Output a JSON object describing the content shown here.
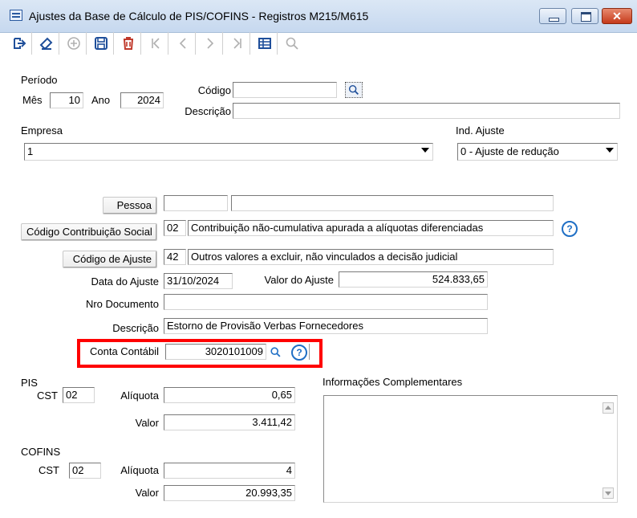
{
  "window": {
    "title": "Ajustes da Base de Cálculo de PIS/COFINS - Registros M215/M615"
  },
  "toolbar": {
    "icons": [
      "exit-icon",
      "eraser-icon",
      "add-icon",
      "save-icon",
      "delete-icon",
      "first-icon",
      "previous-icon",
      "next-icon",
      "last-icon",
      "grid-icon",
      "search-icon"
    ]
  },
  "periodo": {
    "label": "Período",
    "mes_label": "Mês",
    "mes": "10",
    "ano_label": "Ano",
    "ano": "2024"
  },
  "codigo": {
    "label": "Código",
    "value": "",
    "descricao_label": "Descrição",
    "descricao": ""
  },
  "empresa": {
    "label": "Empresa",
    "value": "1"
  },
  "ind_ajuste": {
    "label": "Ind. Ajuste",
    "value": "0 - Ajuste de redução"
  },
  "pessoa": {
    "label": "Pessoa",
    "code": "",
    "name": ""
  },
  "contrib": {
    "label": "Código Contribuição Social",
    "code": "02",
    "desc": "Contribuição não-cumulativa apurada a alíquotas diferenciadas"
  },
  "ajuste": {
    "label": "Código de Ajuste",
    "code": "42",
    "desc": "Outros valores a excluir, não vinculados a decisão judicial"
  },
  "data_ajuste": {
    "label": "Data do Ajuste",
    "value": "31/10/2024"
  },
  "valor_ajuste": {
    "label": "Valor do Ajuste",
    "value": "524.833,65"
  },
  "nro_documento": {
    "label": "Nro Documento",
    "value": ""
  },
  "descricao_geral": {
    "label": "Descrição",
    "value": "Estorno de Provisão Verbas Fornecedores"
  },
  "conta_contabil": {
    "label": "Conta Contábil",
    "value": "3020101009"
  },
  "pis": {
    "title": "PIS",
    "cst_label": "CST",
    "cst": "02",
    "aliquota_label": "Alíquota",
    "aliquota": "0,65",
    "valor_label": "Valor",
    "valor": "3.411,42"
  },
  "cofins": {
    "title": "COFINS",
    "cst_label": "CST",
    "cst": "02",
    "aliquota_label": "Alíquota",
    "aliquota": "4",
    "valor_label": "Valor",
    "valor": "20.993,35"
  },
  "info": {
    "label": "Informações Complementares",
    "value": ""
  },
  "colors": {
    "highlight": "#ff0000",
    "accent": "#1f6fc5",
    "delete": "#c0392b"
  }
}
